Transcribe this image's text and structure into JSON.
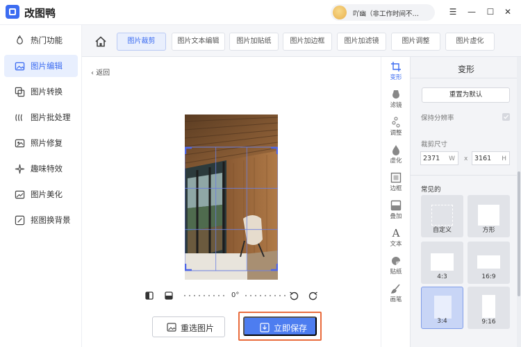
{
  "app": {
    "title": "改图鸭",
    "user_name": "吖幽（非工作时间不…"
  },
  "window_controls": {
    "menu": "☰",
    "minimize": "—",
    "maximize": "☐",
    "close": "✕"
  },
  "sidebar": {
    "items": [
      {
        "label": "热门功能",
        "icon": "fire-icon"
      },
      {
        "label": "图片编辑",
        "icon": "image-edit-icon",
        "active": true
      },
      {
        "label": "图片转换",
        "icon": "image-convert-icon"
      },
      {
        "label": "图片批处理",
        "icon": "batch-icon"
      },
      {
        "label": "照片修复",
        "icon": "photo-repair-icon"
      },
      {
        "label": "趣味特效",
        "icon": "sparkle-icon"
      },
      {
        "label": "图片美化",
        "icon": "beautify-icon"
      },
      {
        "label": "抠图换背景",
        "icon": "cutout-icon"
      }
    ]
  },
  "toolbar": {
    "tabs": [
      {
        "label": "图片裁剪",
        "active": true
      },
      {
        "label": "图片文本编辑"
      },
      {
        "label": "图片加贴纸"
      },
      {
        "label": "图片加边框"
      },
      {
        "label": "图片加滤镜"
      },
      {
        "label": "图片调整"
      },
      {
        "label": "图片虚化"
      }
    ]
  },
  "editor": {
    "back_label": "返回",
    "rotation_value": "0°",
    "reselect_label": "重选图片",
    "save_label": "立即保存"
  },
  "tools": [
    {
      "label": "变形",
      "active": true
    },
    {
      "label": "滤镜"
    },
    {
      "label": "调整"
    },
    {
      "label": "虚化"
    },
    {
      "label": "边框"
    },
    {
      "label": "叠加"
    },
    {
      "label": "文本"
    },
    {
      "label": "贴纸"
    },
    {
      "label": "画笔"
    }
  ],
  "panel": {
    "title": "变形",
    "reset_label": "重置为默认",
    "keep_resolution_label": "保持分辨率",
    "crop_size_label": "裁剪尺寸",
    "width_value": "2371",
    "width_unit": "W",
    "height_value": "3161",
    "height_unit": "H",
    "times": "x",
    "common_label": "常见的",
    "presets": [
      {
        "label": "自定义"
      },
      {
        "label": "方形"
      },
      {
        "label": "4:3"
      },
      {
        "label": "16:9"
      },
      {
        "label": "3:4",
        "active": true
      },
      {
        "label": "9:16"
      }
    ]
  },
  "colors": {
    "accent": "#3c6cf1",
    "save_button": "#4d7df0",
    "highlight_border": "#e96b3c"
  }
}
